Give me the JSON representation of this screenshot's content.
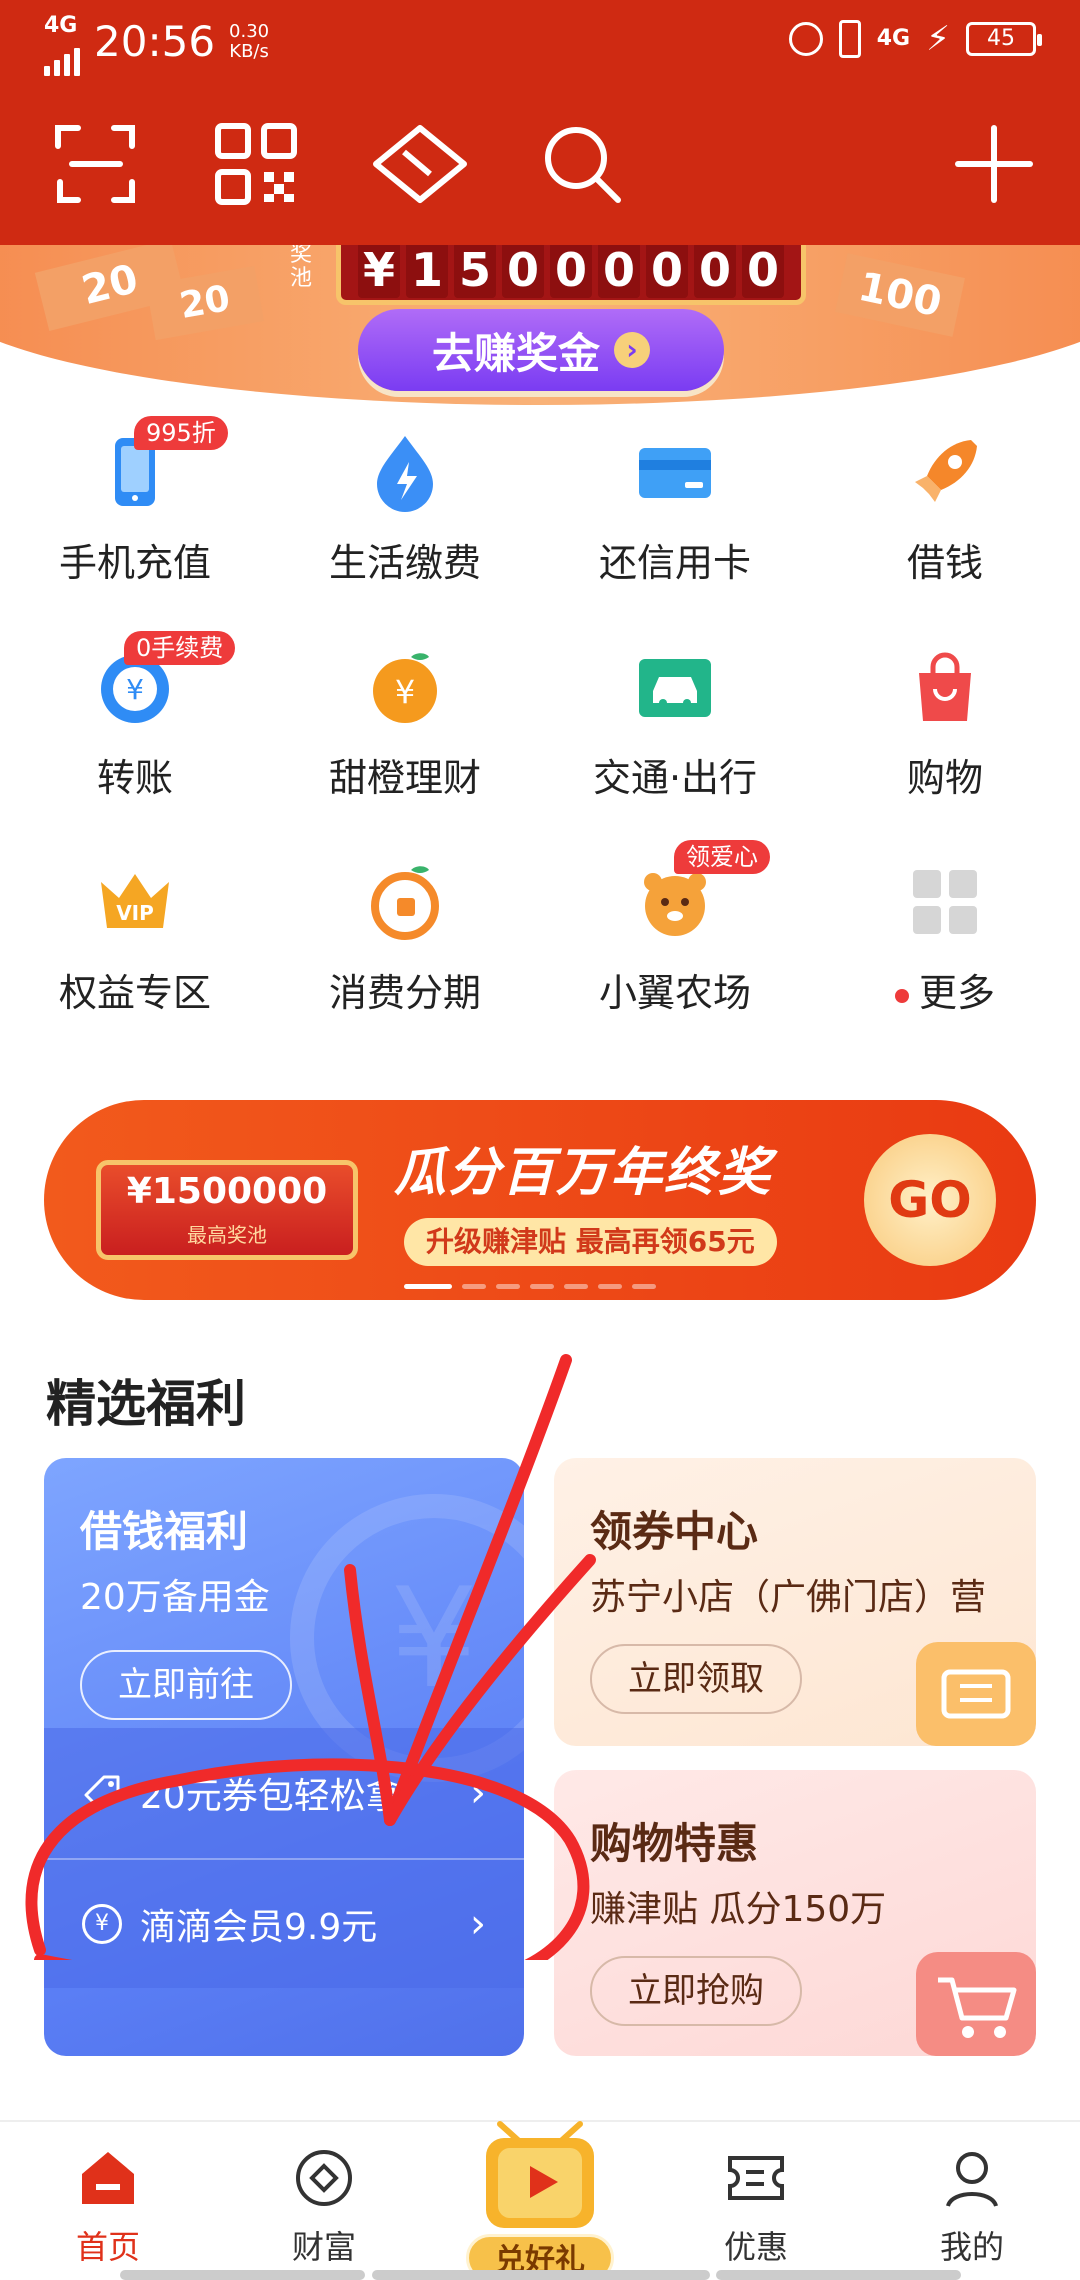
{
  "status": {
    "network": "4G",
    "time": "20:56",
    "speed_value": "0.30",
    "speed_unit": "KB/s",
    "network2": "4G",
    "battery": "45"
  },
  "banner_top": {
    "pool_label": "奖池",
    "counter": [
      "¥",
      "1",
      "5",
      "0",
      "0",
      "0",
      "0",
      "0",
      "0"
    ],
    "earn_button": "去赚奖金",
    "deco_numbers": [
      "20",
      "20",
      "100"
    ]
  },
  "grid": [
    {
      "label": "手机充值",
      "badge": "995折",
      "icon": "phone-icon",
      "color": "#2f8cf5"
    },
    {
      "label": "生活缴费",
      "badge": "",
      "icon": "drop-bolt-icon",
      "color": "#3b8ff6"
    },
    {
      "label": "还信用卡",
      "badge": "",
      "icon": "credit-card-icon",
      "color": "#3fa0f6"
    },
    {
      "label": "借钱",
      "badge": "",
      "icon": "rocket-icon",
      "color": "#f5872a"
    },
    {
      "label": "转账",
      "badge": "0手续费",
      "icon": "transfer-yuan-icon",
      "color": "#2f8cf5"
    },
    {
      "label": "甜橙理财",
      "badge": "",
      "icon": "orange-yuan-icon",
      "color": "#f59a1e"
    },
    {
      "label": "交通·出行",
      "badge": "",
      "icon": "car-icon",
      "color": "#22b58a"
    },
    {
      "label": "购物",
      "badge": "",
      "icon": "shopping-bag-icon",
      "color": "#ef4a4a"
    },
    {
      "label": "权益专区",
      "badge": "",
      "icon": "vip-crown-icon",
      "color": "#f5a623"
    },
    {
      "label": "消费分期",
      "badge": "",
      "icon": "orange-bag-icon",
      "color": "#f58a2a"
    },
    {
      "label": "小翼农场",
      "badge": "领爱心",
      "icon": "farm-animal-icon",
      "color": "#f5a23a"
    },
    {
      "label": "更多",
      "badge": "",
      "icon": "more-grid-icon",
      "color": "#d6d6d6"
    }
  ],
  "promo": {
    "amount": "¥1500000",
    "amount_sub": "最高奖池",
    "title": "瓜分百万年终奖",
    "subtitle": "升级赚津贴 最高再领65元",
    "go": "GO"
  },
  "section_title": "精选福利",
  "card_loan": {
    "title": "借钱福利",
    "subtitle": "20万备用金",
    "button": "立即前往",
    "row1": "20元券包轻松拿",
    "row2": "滴滴会员9.9元",
    "row2_icon": "¥"
  },
  "card_coupon": {
    "title": "领券中心",
    "subtitle": "苏宁小店（广佛门店）营",
    "button": "立即领取"
  },
  "card_shop": {
    "title": "购物特惠",
    "subtitle": "赚津贴 瓜分150万",
    "button": "立即抢购"
  },
  "bottom_nav": {
    "home": "首页",
    "wealth": "财富",
    "gift": "兑好礼",
    "discount": "优惠",
    "mine": "我的"
  },
  "colors": {
    "header": "#cf2a12",
    "accent": "#e0311a",
    "annotation": "#f02a2a"
  }
}
